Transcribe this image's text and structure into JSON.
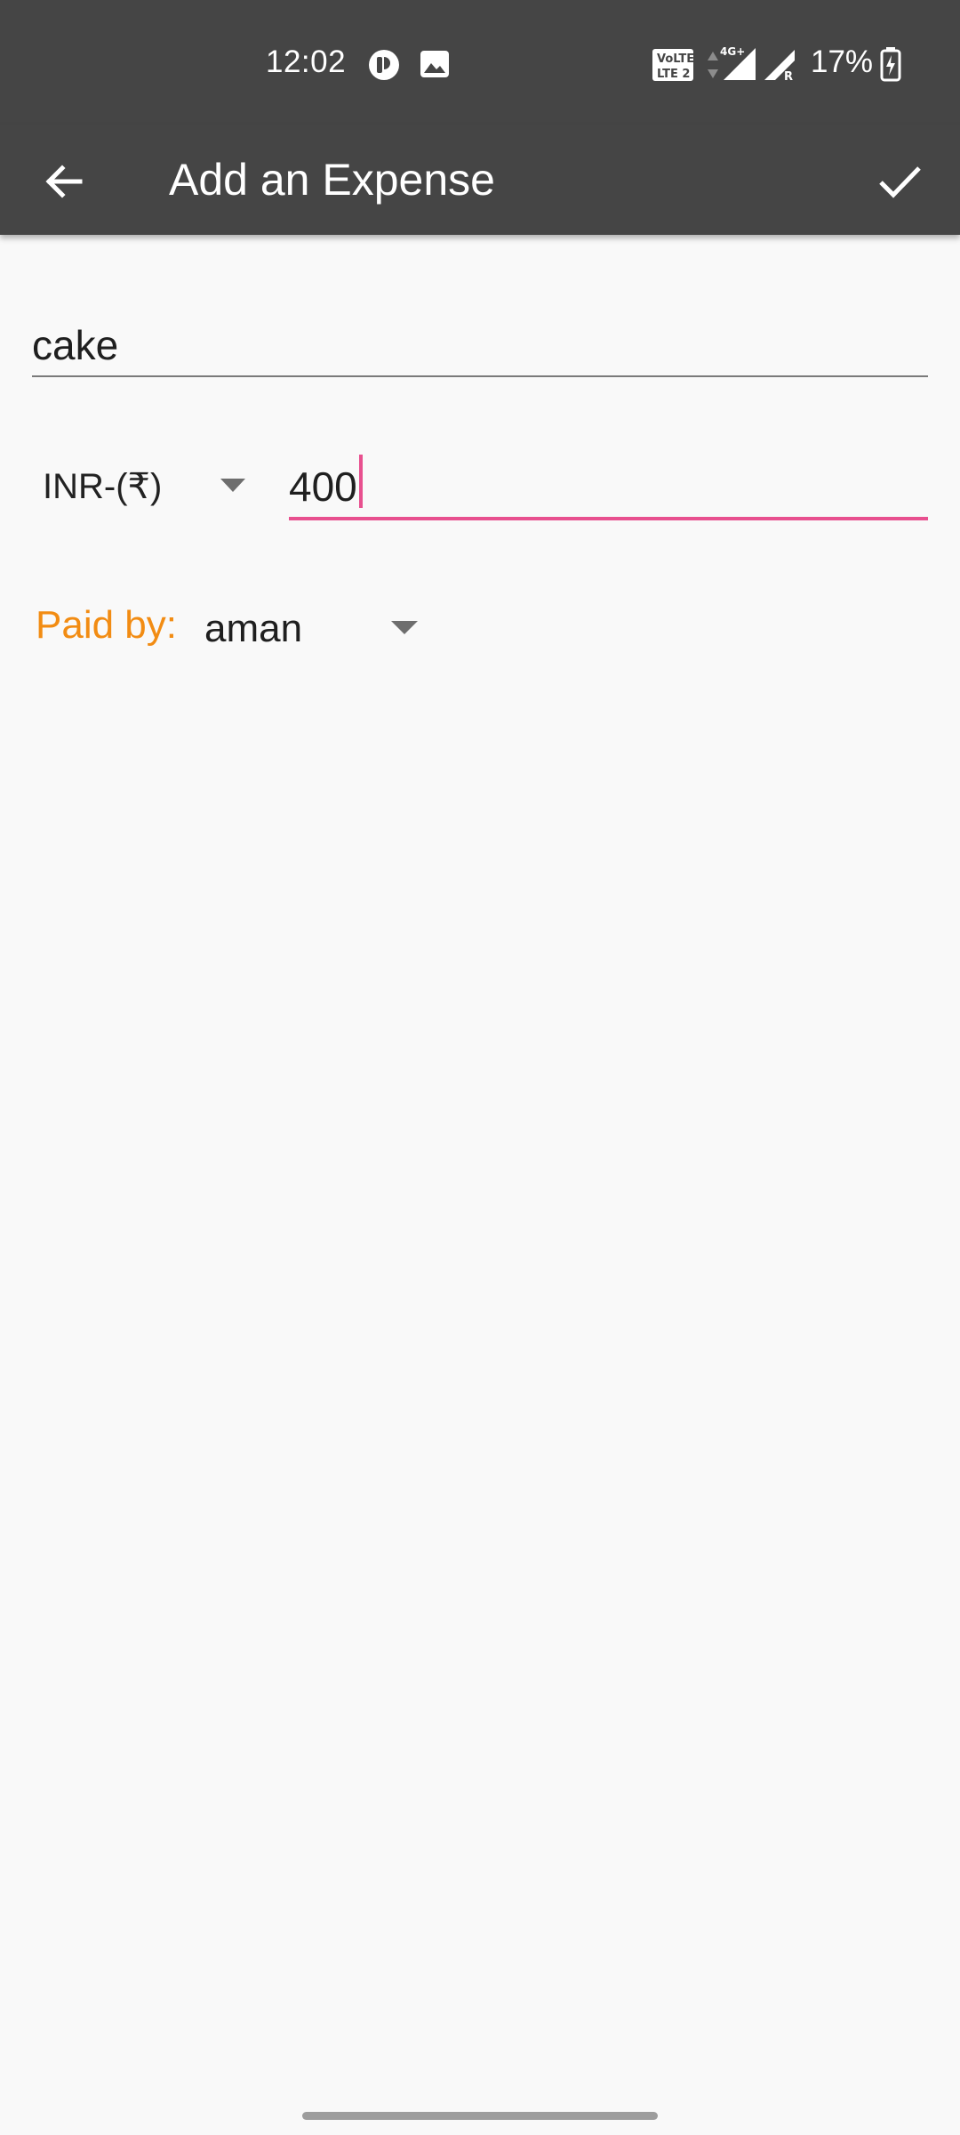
{
  "status_bar": {
    "time": "12:02",
    "battery_percent": "17%",
    "icons": [
      "notification-app-icon",
      "gallery-icon",
      "volte-lte2-icon",
      "data-arrows-icon",
      "signal-4g-icon",
      "signal-roaming-icon",
      "battery-charging-icon"
    ],
    "network_label": "4G+",
    "roaming_label": "R",
    "volte_top": "VoLTE",
    "volte_bottom": "LTE 2"
  },
  "app_bar": {
    "title": "Add an Expense",
    "back_icon": "arrow-back-icon",
    "done_icon": "check-icon"
  },
  "form": {
    "description_value": "cake",
    "currency_value": "INR-(₹)",
    "amount_value": "400",
    "paid_by_label": "Paid by:",
    "payer_value": "aman"
  },
  "colors": {
    "bar_background": "#454545",
    "accent_pink": "#e8508f",
    "label_orange": "#f28c13",
    "background": "#f9f9f9"
  }
}
